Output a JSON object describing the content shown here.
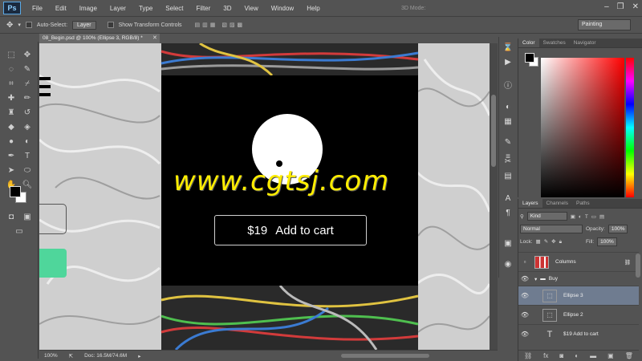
{
  "menubar": {
    "logo": "Ps",
    "items": [
      "File",
      "Edit",
      "Image",
      "Layer",
      "Type",
      "Select",
      "Filter",
      "3D",
      "View",
      "Window",
      "Help"
    ]
  },
  "options": {
    "auto_select_label": "Auto-Select:",
    "auto_select_value": "Layer",
    "transform_label": "Show Transform Controls",
    "mode_3d": "3D Mode:",
    "workspace": "Painting"
  },
  "document": {
    "tab_title": "08_Begin.psd @ 100% (Ellipse 3, RGB/8) *",
    "button_price": "$19",
    "button_label": "Add to cart",
    "watermark": "www.cgtsj.com"
  },
  "status": {
    "zoom": "100%",
    "doc_size": "Doc: 16.5M/74.6M"
  },
  "color_panel": {
    "tabs": [
      "Color",
      "Swatches",
      "Navigator"
    ]
  },
  "layers_panel": {
    "tabs": [
      "Layers",
      "Channels",
      "Paths"
    ],
    "filter": "Kind",
    "blend_mode": "Normal",
    "opacity_label": "Opacity:",
    "opacity": "100%",
    "lock_label": "Lock:",
    "fill_label": "Fill:",
    "fill": "100%",
    "layers": [
      {
        "name": "Columns",
        "selected": false
      },
      {
        "name": "Buy",
        "selected": false
      },
      {
        "name": "Ellipse 3",
        "selected": true
      },
      {
        "name": "Ellipse 2",
        "selected": false
      },
      {
        "name": "$19   Add to cart",
        "selected": false
      }
    ]
  },
  "colors": {
    "accent_green": "#4fd69b",
    "watermark": "#ffee00",
    "selection": "#6f7c90"
  }
}
